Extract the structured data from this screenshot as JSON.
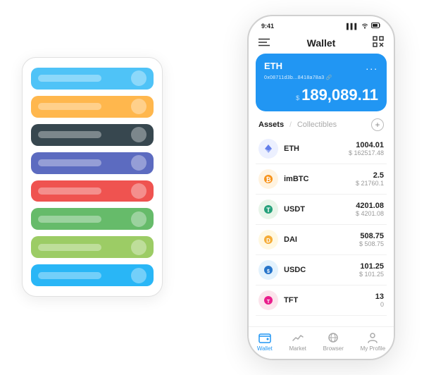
{
  "app": {
    "title": "Wallet"
  },
  "statusBar": {
    "time": "9:41",
    "signal": "▌▌▌",
    "wifi": "WiFi",
    "battery": "🔋"
  },
  "header": {
    "menuIcon": "☰",
    "title": "Wallet",
    "scanIcon": "⇄"
  },
  "ethCard": {
    "label": "ETH",
    "dotsMenu": "...",
    "address": "0x08711d3b...8418a78a3",
    "addressIcon": "🔗",
    "currency": "$",
    "balance": "189,089.11"
  },
  "assetsTabs": {
    "activeTab": "Assets",
    "slash": "/",
    "inactiveTab": "Collectibles",
    "addIcon": "+"
  },
  "assets": [
    {
      "name": "ETH",
      "amount": "1004.01",
      "usd": "$ 162517.48",
      "icon": "♦",
      "iconBg": "eth-icon-bg"
    },
    {
      "name": "imBTC",
      "amount": "2.5",
      "usd": "$ 21760.1",
      "icon": "₿",
      "iconBg": "imbtc-icon-bg"
    },
    {
      "name": "USDT",
      "amount": "4201.08",
      "usd": "$ 4201.08",
      "icon": "₮",
      "iconBg": "usdt-icon-bg"
    },
    {
      "name": "DAI",
      "amount": "508.75",
      "usd": "$ 508.75",
      "icon": "◈",
      "iconBg": "dai-icon-bg"
    },
    {
      "name": "USDC",
      "amount": "101.25",
      "usd": "$ 101.25",
      "icon": "©",
      "iconBg": "usdc-icon-bg"
    },
    {
      "name": "TFT",
      "amount": "13",
      "usd": "0",
      "icon": "🌿",
      "iconBg": "tft-icon-bg"
    }
  ],
  "bottomNav": [
    {
      "label": "Wallet",
      "active": true
    },
    {
      "label": "Market",
      "active": false
    },
    {
      "label": "Browser",
      "active": false
    },
    {
      "label": "My Profile",
      "active": false
    }
  ],
  "leftPanel": {
    "cards": [
      {
        "color": "card-blue"
      },
      {
        "color": "card-orange"
      },
      {
        "color": "card-dark"
      },
      {
        "color": "card-purple"
      },
      {
        "color": "card-red"
      },
      {
        "color": "card-green"
      },
      {
        "color": "card-lightgreen"
      },
      {
        "color": "card-lightblue"
      }
    ]
  }
}
